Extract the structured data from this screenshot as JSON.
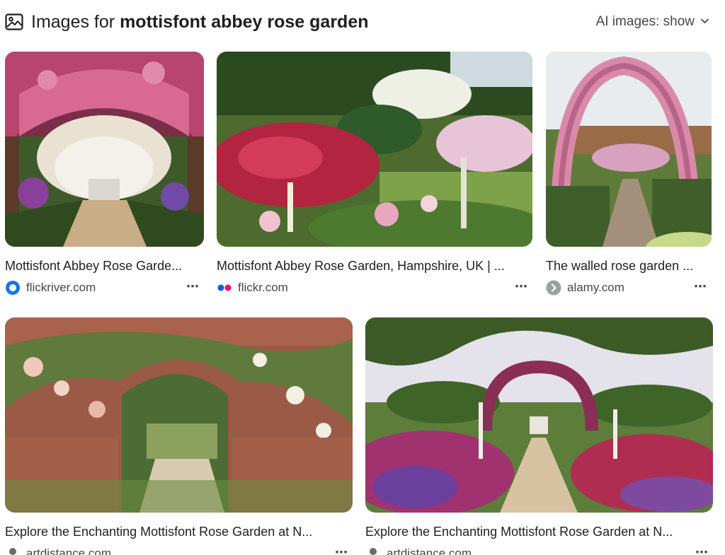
{
  "header": {
    "title_prefix": "Images for ",
    "title_query": "mottisfont abbey rose garden",
    "ai_toggle_label": "AI images: show"
  },
  "results": [
    {
      "caption": "Mottisfont Abbey Rose Garde...",
      "source": "flickriver.com",
      "favicon": "flickriver-icon",
      "image": "rose-arch-tunnel-photo"
    },
    {
      "caption": "Mottisfont Abbey Rose Garden, Hampshire, UK | ...",
      "source": "flickr.com",
      "favicon": "flickr-icon",
      "image": "rose-borders-photo"
    },
    {
      "caption": "The walled rose garden ...",
      "source": "alamy.com",
      "favicon": "alamy-icon",
      "image": "rose-arch-path-photo"
    },
    {
      "caption": "Explore the Enchanting Mottisfont Rose Garden at N...",
      "source": "artdistance.com",
      "favicon": "artdistance-icon",
      "image": "brick-wall-arch-photo"
    },
    {
      "caption": "Explore the Enchanting Mottisfont Rose Garden at N...",
      "source": "artdistance.com",
      "favicon": "artdistance-icon",
      "image": "gravel-path-borders-photo"
    }
  ],
  "colors": {
    "text": "#1f1f1f",
    "muted": "#474747",
    "flickr_blue": "#0063dc",
    "flickr_pink": "#ff0084"
  }
}
